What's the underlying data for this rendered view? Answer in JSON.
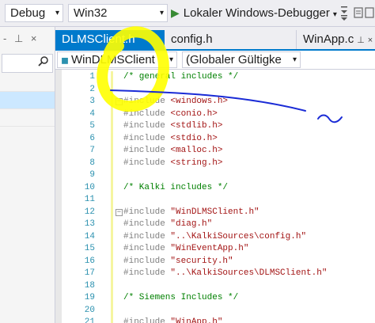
{
  "toolbar": {
    "configuration": "Debug",
    "platform": "Win32",
    "run_label": "Lokaler Windows-Debugger",
    "dropdown_glyph": "▾"
  },
  "left_panel": {
    "pin_glyph": "- ⊥ ×"
  },
  "tabs": [
    {
      "label": "DLMSClient.h"
    },
    {
      "label": "config.h"
    },
    {
      "label": "WinApp.c"
    }
  ],
  "navbar": {
    "scope": "WinDLMSClient",
    "member": "(Globaler Gültigke"
  },
  "editor": {
    "lines": [
      {
        "n": "1",
        "pre": "",
        "cm": "/* general includes */",
        "st": ""
      },
      {
        "n": "2",
        "pre": "",
        "cm": "",
        "st": ""
      },
      {
        "n": "3",
        "pre": "#include ",
        "cm": "",
        "st": "<windows.h>"
      },
      {
        "n": "4",
        "pre": "#include ",
        "cm": "",
        "st": "<conio.h>"
      },
      {
        "n": "5",
        "pre": "#include ",
        "cm": "",
        "st": "<stdlib.h>"
      },
      {
        "n": "6",
        "pre": "#include ",
        "cm": "",
        "st": "<stdio.h>"
      },
      {
        "n": "7",
        "pre": "#include ",
        "cm": "",
        "st": "<malloc.h>"
      },
      {
        "n": "8",
        "pre": "#include ",
        "cm": "",
        "st": "<string.h>"
      },
      {
        "n": "9",
        "pre": "",
        "cm": "",
        "st": ""
      },
      {
        "n": "10",
        "pre": "",
        "cm": "/* Kalki includes */",
        "st": ""
      },
      {
        "n": "11",
        "pre": "",
        "cm": "",
        "st": ""
      },
      {
        "n": "12",
        "pre": "#include ",
        "cm": "",
        "st": "\"WinDLMSClient.h\""
      },
      {
        "n": "13",
        "pre": "#include ",
        "cm": "",
        "st": "\"diag.h\""
      },
      {
        "n": "14",
        "pre": "#include ",
        "cm": "",
        "st": "\"..\\KalkiSources\\config.h\""
      },
      {
        "n": "15",
        "pre": "#include ",
        "cm": "",
        "st": "\"WinEventApp.h\""
      },
      {
        "n": "16",
        "pre": "#include ",
        "cm": "",
        "st": "\"security.h\""
      },
      {
        "n": "17",
        "pre": "#include ",
        "cm": "",
        "st": "\"..\\KalkiSources\\DLMSClient.h\""
      },
      {
        "n": "18",
        "pre": "",
        "cm": "",
        "st": ""
      },
      {
        "n": "19",
        "pre": "",
        "cm": "/* Siemens Includes */",
        "st": ""
      },
      {
        "n": "20",
        "pre": "",
        "cm": "",
        "st": ""
      },
      {
        "n": "21",
        "pre": "#include ",
        "cm": "",
        "st": "\"WinApp.h\""
      }
    ]
  },
  "colors": {
    "accent": "#007acc",
    "highlighter": "#ffff00",
    "pen": "#1a2bd6"
  }
}
